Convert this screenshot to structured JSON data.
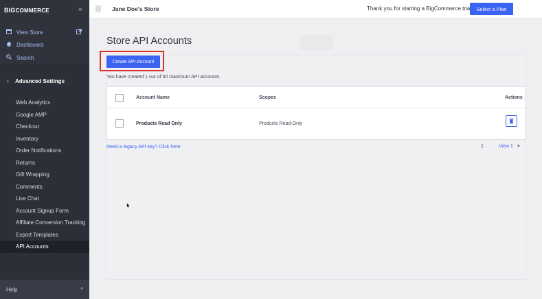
{
  "sidebar": {
    "logo_prefix": "BIG",
    "logo_suffix": "COMMERCE",
    "collapse": "«",
    "view_store": "View Store",
    "dashboard": "Dashboard",
    "search": "Search",
    "section_title": "Advanced Settings",
    "items": [
      {
        "label": "Web Analytics"
      },
      {
        "label": "Google AMP"
      },
      {
        "label": "Checkout"
      },
      {
        "label": "Inventory"
      },
      {
        "label": "Order Notifications"
      },
      {
        "label": "Returns"
      },
      {
        "label": "Gift Wrapping"
      },
      {
        "label": "Comments"
      },
      {
        "label": "Live Chat"
      },
      {
        "label": "Account Signup Form"
      },
      {
        "label": "Affiliate Conversion Tracking"
      },
      {
        "label": "Export Templates"
      },
      {
        "label": "API Accounts"
      }
    ],
    "active_item": "API Accounts",
    "help": "Help",
    "help_caret": "^"
  },
  "topbar": {
    "store_name": "Jane Doe's Store",
    "trial_text": "Thank you for starting a BigCommerce trial.",
    "select_plan": "Select a Plan"
  },
  "main": {
    "title": "Store API Accounts",
    "create_button": "Create API Account",
    "counter_text": "You have created 1 out of 50 maximum API accounts.",
    "table": {
      "headers": {
        "name": "Account Name",
        "scopes": "Scopes",
        "actions": "Actions"
      },
      "rows": [
        {
          "name": "Products Read Only",
          "scopes": "Products Read-Only"
        }
      ]
    },
    "legacy_link": "Need a legacy API key? Click here.",
    "pagination": {
      "page": "1",
      "view_label": "View 1",
      "caret": "▾"
    }
  },
  "colors": {
    "accent": "#3c64f4",
    "sidebar_bg": "#2d2f38",
    "highlight_border": "#d6302a"
  }
}
